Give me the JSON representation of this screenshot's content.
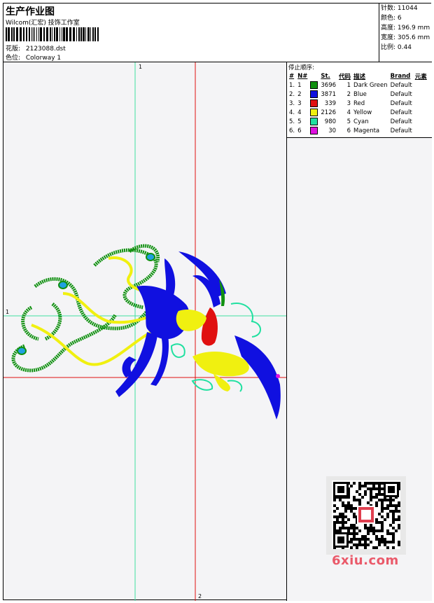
{
  "header": {
    "title": "生产作业图",
    "company": "Wilcom(汇宏) 技饰工作室",
    "design_label": "花版:",
    "design_value": "2123088.dst",
    "color_label": "色位:",
    "color_value": "Colorway 1"
  },
  "stats": [
    {
      "label": "针数:",
      "value": "11044"
    },
    {
      "label": "颜色:",
      "value": "6"
    },
    {
      "label": "高度:",
      "value": "196.9 mm"
    },
    {
      "label": "宽度:",
      "value": "305.6 mm"
    },
    {
      "label": "比例:",
      "value": "0.44"
    }
  ],
  "stop_sequence": {
    "title": "停止顺序:",
    "columns": [
      "#",
      "N#",
      "St.",
      "代码",
      "描述",
      "Brand",
      "元素"
    ],
    "rows": [
      {
        "num": "1.",
        "n": "1",
        "color": "#109010",
        "st": "3696",
        "code": "1",
        "desc": "Dark Green",
        "brand": "Default"
      },
      {
        "num": "2.",
        "n": "2",
        "color": "#1010e0",
        "st": "3871",
        "code": "2",
        "desc": "Blue",
        "brand": "Default"
      },
      {
        "num": "3.",
        "n": "3",
        "color": "#e01010",
        "st": "339",
        "code": "3",
        "desc": "Red",
        "brand": "Default"
      },
      {
        "num": "4.",
        "n": "4",
        "color": "#f0f010",
        "st": "2126",
        "code": "4",
        "desc": "Yellow",
        "brand": "Default"
      },
      {
        "num": "5.",
        "n": "5",
        "color": "#20e0a0",
        "st": "980",
        "code": "5",
        "desc": "Cyan",
        "brand": "Default"
      },
      {
        "num": "6.",
        "n": "6",
        "color": "#e010e0",
        "st": "30",
        "code": "6",
        "desc": "Magenta",
        "brand": "Default"
      }
    ]
  },
  "axes": {
    "top_marker": "1",
    "left_marker": "1",
    "bottom_marker": "2"
  },
  "watermark": {
    "site": "6xiu.com"
  }
}
